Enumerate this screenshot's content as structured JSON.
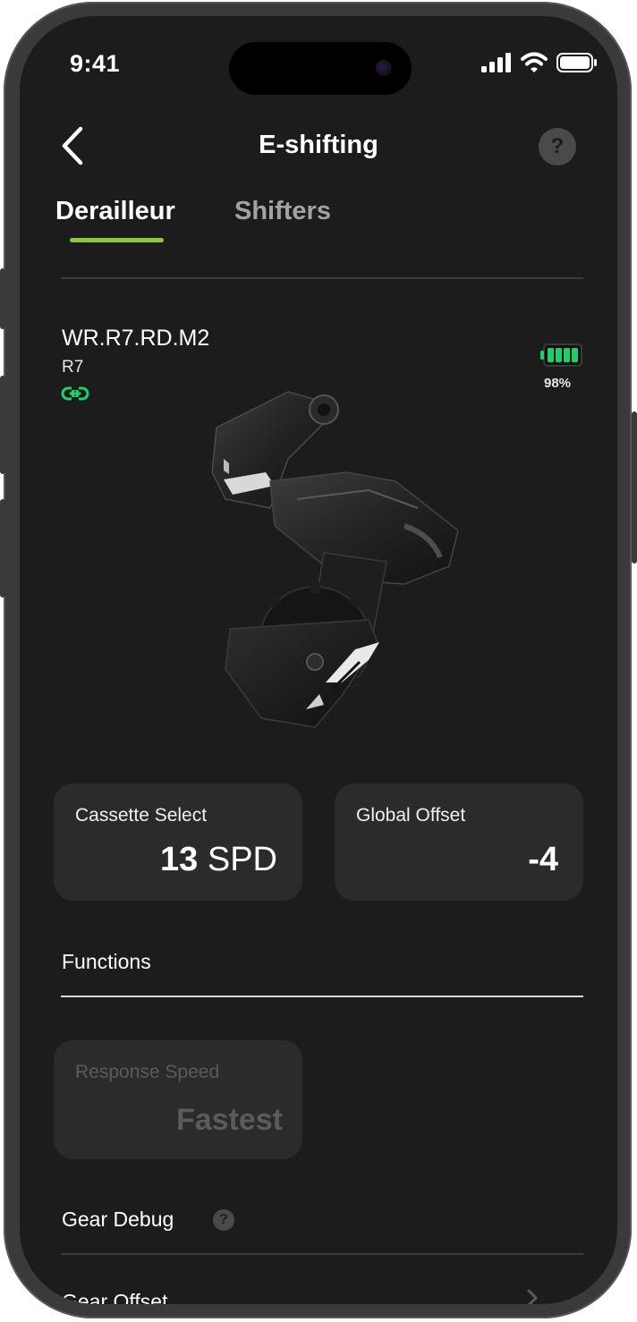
{
  "status_bar": {
    "time": "9:41"
  },
  "header": {
    "title": "E-shifting",
    "help_glyph": "?"
  },
  "tabs": [
    {
      "label": "Derailleur",
      "active": true
    },
    {
      "label": "Shifters",
      "active": false
    }
  ],
  "device": {
    "name": "WR.R7.RD.M2",
    "model": "R7",
    "battery_percent_label": "98%",
    "battery_level": 0.98,
    "connection_icon": "link-icon",
    "status_color": "#1fcf6b"
  },
  "cards": {
    "cassette": {
      "label": "Cassette Select",
      "value_bold": "13",
      "value_unit": " SPD"
    },
    "offset": {
      "label": "Global Offset",
      "value": "-4"
    }
  },
  "functions": {
    "title": "Functions",
    "response_speed": {
      "label": "Response Speed",
      "value": "Fastest",
      "enabled": false
    }
  },
  "gear_debug": {
    "title": "Gear Debug",
    "help_glyph": "?"
  },
  "gear_offset": {
    "label": "Gear Offset"
  },
  "colors": {
    "accent": "#8dc63f",
    "background": "#1c1c1c",
    "card": "#2b2b2b"
  }
}
